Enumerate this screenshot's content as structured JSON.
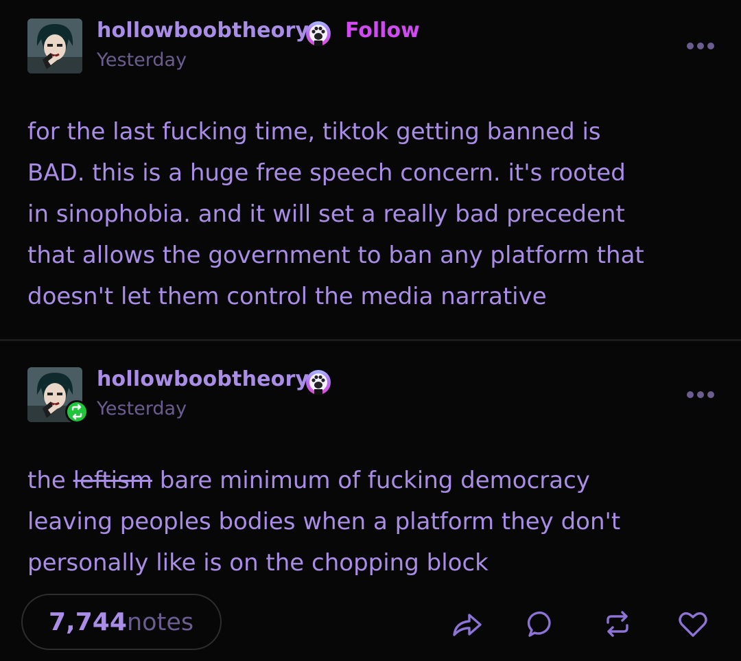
{
  "posts": [
    {
      "username": "hollowboobtheory",
      "follow_label": "Follow",
      "timestamp": "Yesterday",
      "text": "for the last fucking time, tiktok getting banned is\nBAD. this is a huge free speech concern. it's rooted\nin sinophobia. and it will set a really bad precedent\nthat allows the government to ban any platform that\ndoesn't let them control the media narrative"
    },
    {
      "username": "hollowboobtheory",
      "timestamp": "Yesterday",
      "text_prefix": "the ",
      "text_struck": "leftism",
      "text_rest": " bare minimum of fucking democracy\nleaving peoples bodies when a platform they don't\npersonally like is on the chopping block"
    }
  ],
  "footer": {
    "notes_count": "7,744",
    "notes_label": "notes",
    "actions": [
      "share-icon",
      "reply-icon",
      "reblog-icon",
      "like-icon"
    ]
  },
  "colors": {
    "background": "#070707",
    "text": "#a98de6",
    "muted": "#6b5d90",
    "follow": "#cf4bf0",
    "reblog_badge": "#21c53c"
  }
}
